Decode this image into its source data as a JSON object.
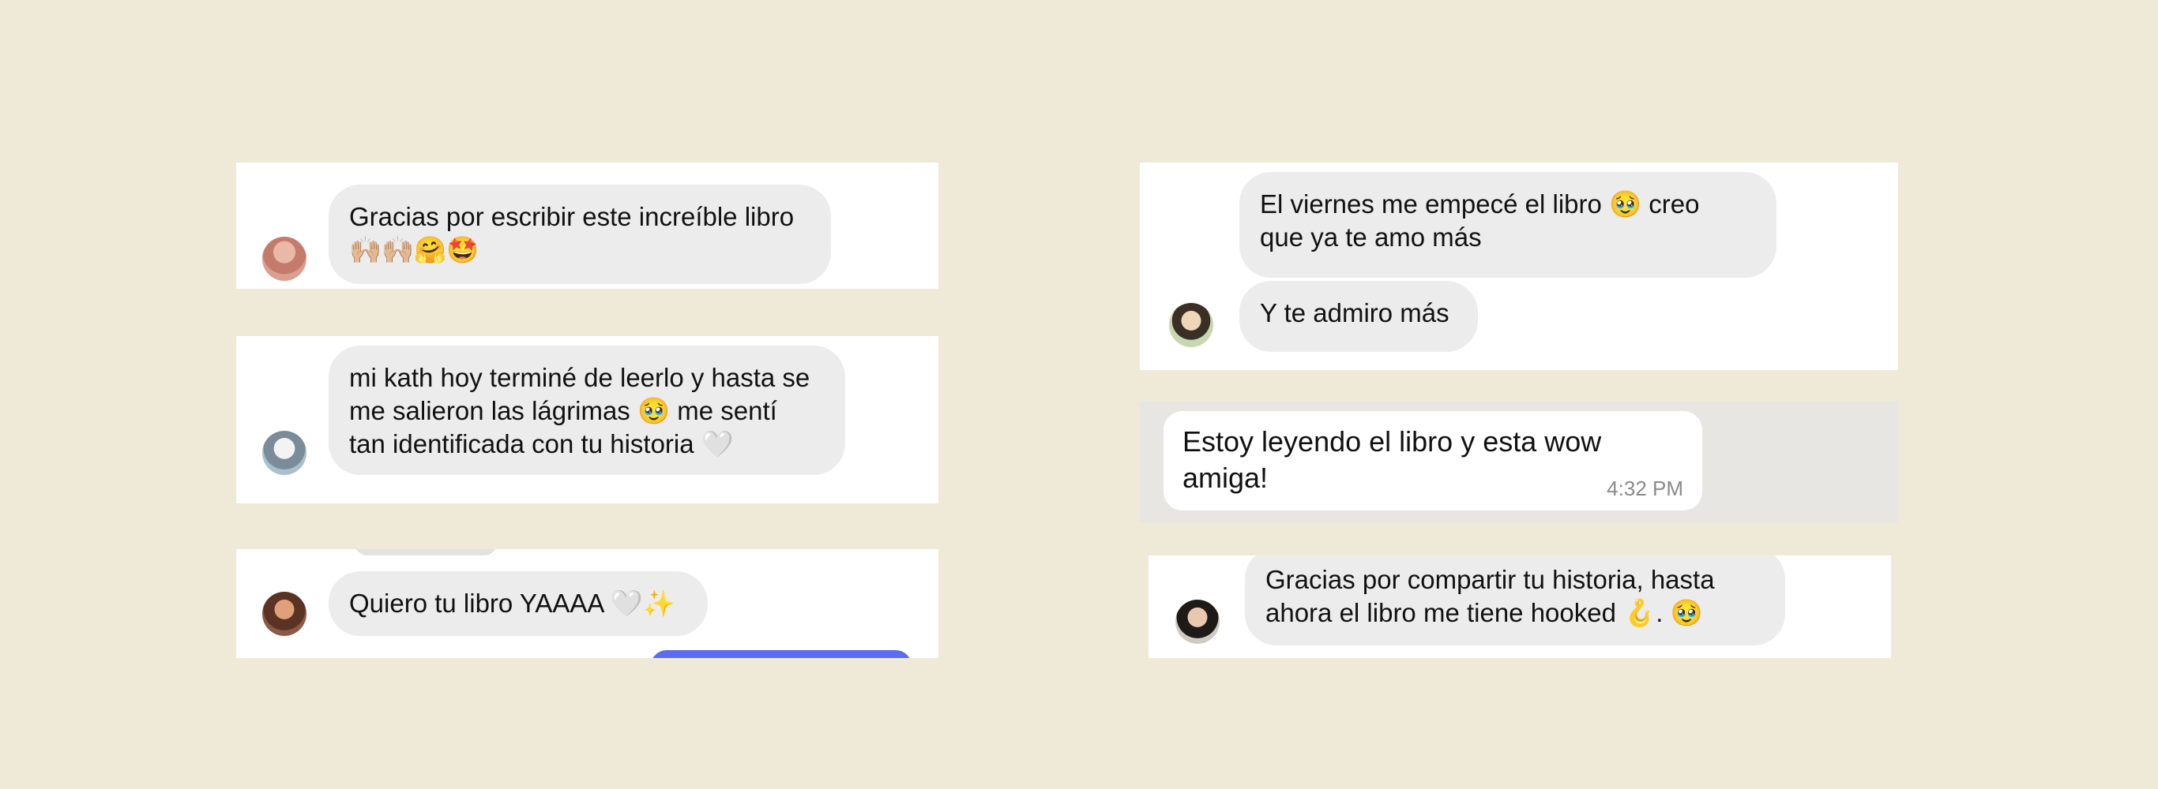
{
  "colors": {
    "background": "#efe9d8",
    "card": "#ffffff",
    "bubble": "#ececec",
    "whatsapp_bg": "#e7e6e3",
    "accent_blue": "#5b6cf0"
  },
  "messages": {
    "m1": {
      "text": "Gracias por escribir este increíble libro\n🙌🏼🙌🏼🤗🤩"
    },
    "m2": {
      "text": "mi kath hoy terminé de leerlo y hasta se\nme salieron las lágrimas 🥹 me sentí\ntan identificada con tu historia 🤍"
    },
    "m3": {
      "text": "Quiero tu libro YAAAA 🤍✨"
    },
    "m4a": {
      "text": "El viernes me empecé el libro 🥹 creo\nque ya te amo más"
    },
    "m4b": {
      "text": "Y te admiro más"
    },
    "m5": {
      "text": "Estoy leyendo el libro y esta wow amiga!",
      "time": "4:32 PM"
    },
    "m6": {
      "text": "Gracias por compartir tu historia, hasta\nahora el libro me tiene hooked 🪝. 🥹"
    }
  }
}
